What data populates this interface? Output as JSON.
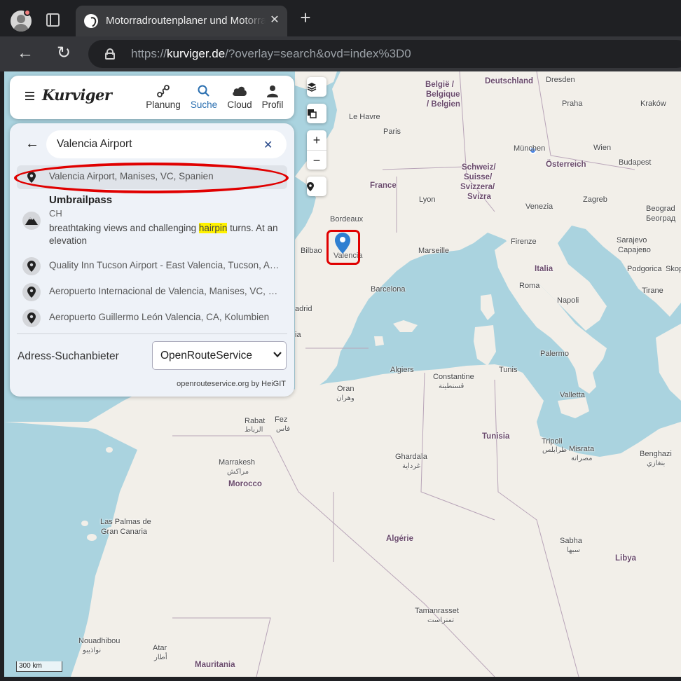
{
  "browser": {
    "tab_title": "Motorradroutenplaner und Motorrad-Navi",
    "url_scheme": "https://",
    "url_host": "kurviger.de",
    "url_rest": "/?overlay=search&ovd=index%3D0"
  },
  "app": {
    "logo": "Kurviger",
    "nav": [
      {
        "label": "Planung",
        "icon": "route-icon"
      },
      {
        "label": "Suche",
        "icon": "search-icon"
      },
      {
        "label": "Cloud",
        "icon": "cloud-icon"
      },
      {
        "label": "Profil",
        "icon": "profile-icon"
      }
    ],
    "active_nav": "Suche",
    "accent": "#2a6fb0"
  },
  "search": {
    "query": "Valencia Airport",
    "results": [
      "Valencia Airport, Manises, VC, Spanien",
      "Quality Inn Tucson Airport - East Valencia, Tucson, AZ, USA",
      "Aeropuerto Internacional de Valencia, Manises, VC, Spanien",
      "Aeropuerto Guillermo León Valencia, CA, Kolumbien"
    ],
    "umbrail": {
      "title": "Umbrailpass",
      "country": "CH",
      "desc_before": "breathtaking views and challenging ",
      "desc_highlight": "hairpin",
      "desc_after": " turns. At an elevation"
    },
    "provider_label": "Adress-Suchanbieter",
    "provider_value": "OpenRouteService",
    "credit": "openrouteservice.org by HeiGIT"
  },
  "map": {
    "scale": "300 km",
    "marker_label": "Valencia",
    "labels": {
      "deutschland": "Deutschland",
      "dresden": "Dresden",
      "belgie1": "België /",
      "belgie2": "Belgique",
      "belgie3": "/ Belgien",
      "praha": "Praha",
      "krakow": "Kraków",
      "lehavre": "Le Havre",
      "paris": "Paris",
      "munchen": "München",
      "wien": "Wien",
      "osterreich": "Österreich",
      "budapest": "Budapest",
      "schweiz1": "Schweiz/",
      "schweiz2": "Suisse/",
      "schweiz3": "Svizzera/",
      "schweiz4": "Svizra",
      "france": "France",
      "lyon": "Lyon",
      "venezia": "Venezia",
      "zagreb": "Zagreb",
      "beograd1": "Beograd",
      "beograd2": "Београд",
      "bordeaux": "Bordeaux",
      "firenze": "Firenze",
      "sarajevo1": "Sarajevo",
      "sarajevo2": "Сарајево",
      "bilbao": "Bilbao",
      "marseille": "Marseille",
      "italia": "Italia",
      "podgorica": "Podgorica",
      "skop": "Skop",
      "tirane": "Tirane",
      "roma": "Roma",
      "barcelona": "Barcelona",
      "madrid": "adrid",
      "napoli": "Napoli",
      "palermo": "Palermo",
      "algiers": "Algiers",
      "tunis": "Tunis",
      "constantine1": "Constantine",
      "constantine2": "قسنطينة",
      "oran1": "Oran",
      "oran2": "وهران",
      "valletta": "Valletta",
      "rabat1": "Rabat",
      "rabat2": "الرباط",
      "fez1": "Fez",
      "fez2": "فاس",
      "tunisia": "Tunisia",
      "tripoli1": "Tripoli",
      "tripoli2": "طرابلس",
      "misrata1": "Misrata",
      "misrata2": "مصراتة",
      "benghazi1": "Benghazi",
      "benghazi2": "بنغازي",
      "ghardaia1": "Ghardaïa",
      "ghardaia2": "غرداية",
      "marrakesh1": "Marrakesh",
      "marrakesh2": "مراكش",
      "morocco": "Morocco",
      "laspalmas1": "Las Palmas de",
      "laspalmas2": "Gran Canaria",
      "algerie": "Algérie",
      "sabha1": "Sabha",
      "sabha2": "سبها",
      "libya": "Libya",
      "tamanrasset1": "Tamanrasset",
      "tamanrasset2": "تمنراست",
      "nouadhibou1": "Nouadhibou",
      "nouadhibou2": "نواذيبو",
      "atar1": "Atar",
      "atar2": "أطار",
      "mauritania": "Mauritania",
      "ia": "ia"
    }
  }
}
